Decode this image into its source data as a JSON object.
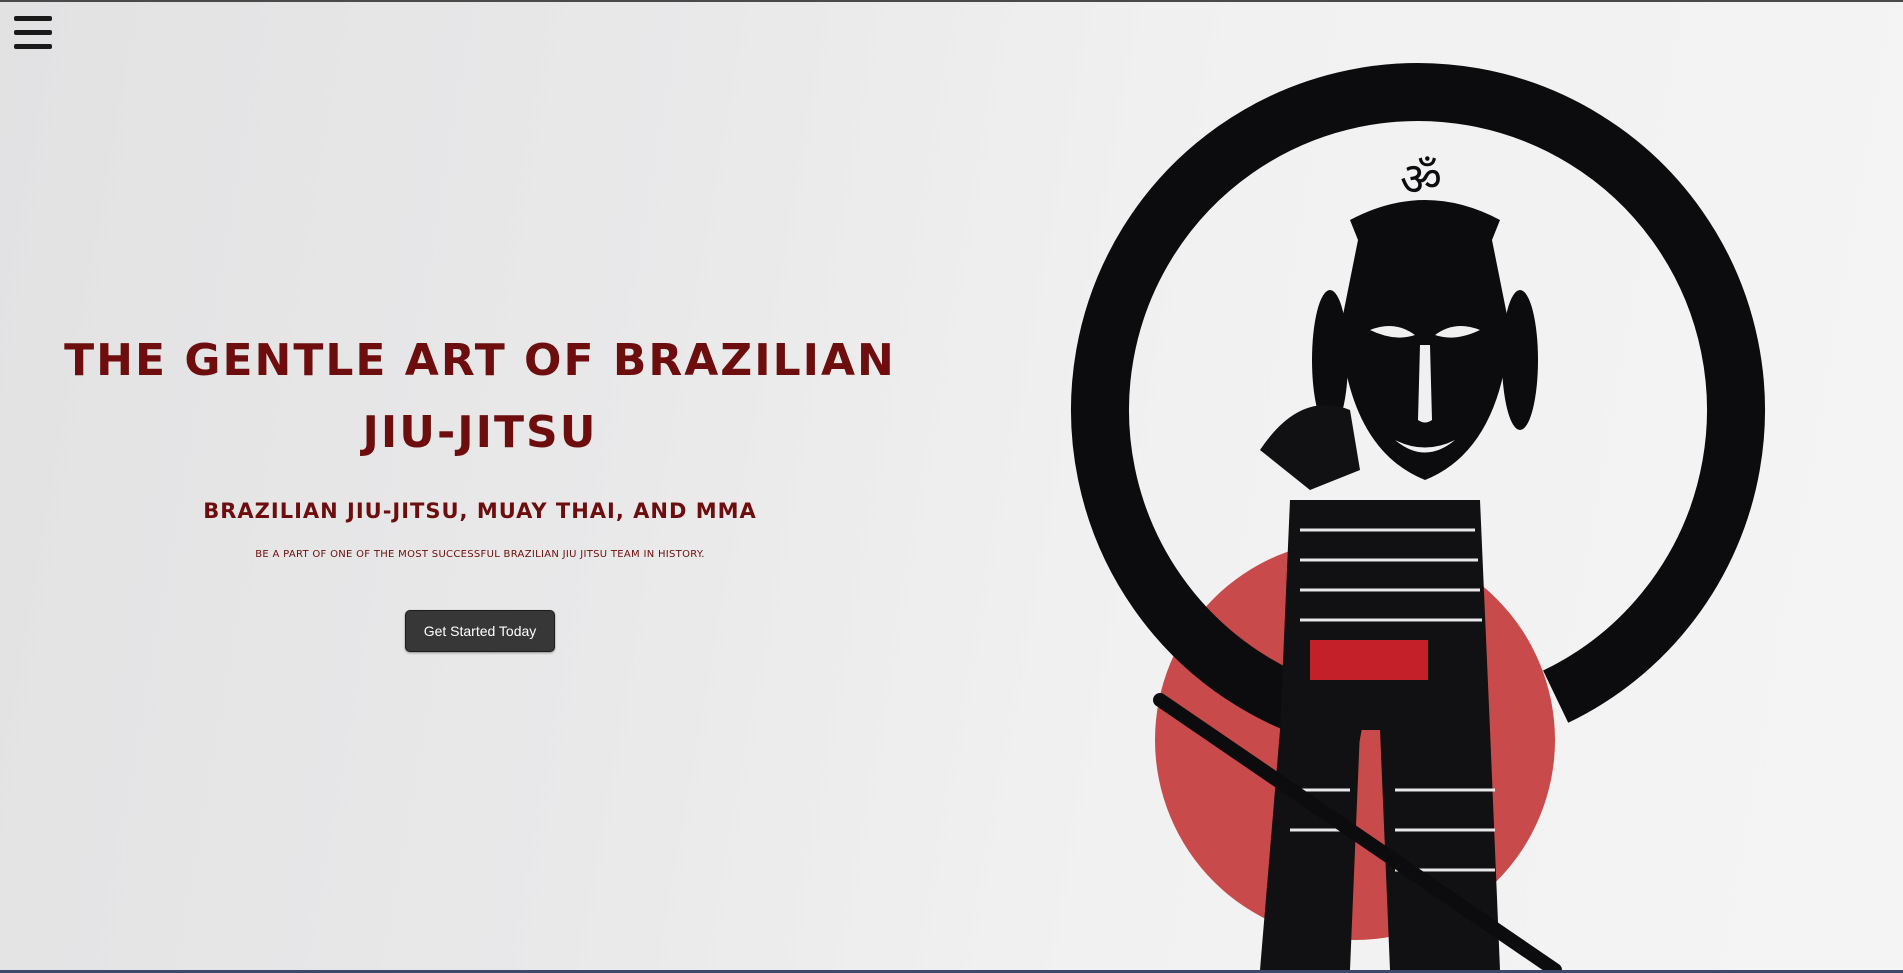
{
  "nav": {
    "menu_icon": "hamburger-menu-icon"
  },
  "hero": {
    "title_line1": "THE GENTLE ART OF BRAZILIAN",
    "title_line2": "JIU-JITSU",
    "subtitle": "BRAZILIAN JIU-JITSU, MUAY THAI, AND MMA",
    "tagline": "BE A PART OF ONE OF THE MOST SUCCESSFUL BRAZILIAN JIU JITSU TEAM IN HISTORY.",
    "cta_label": "Get Started Today"
  },
  "colors": {
    "accent": "#6d0d0d",
    "button_bg": "#373737",
    "sun_red": "#c94a4a",
    "belt_red": "#c4202a"
  }
}
